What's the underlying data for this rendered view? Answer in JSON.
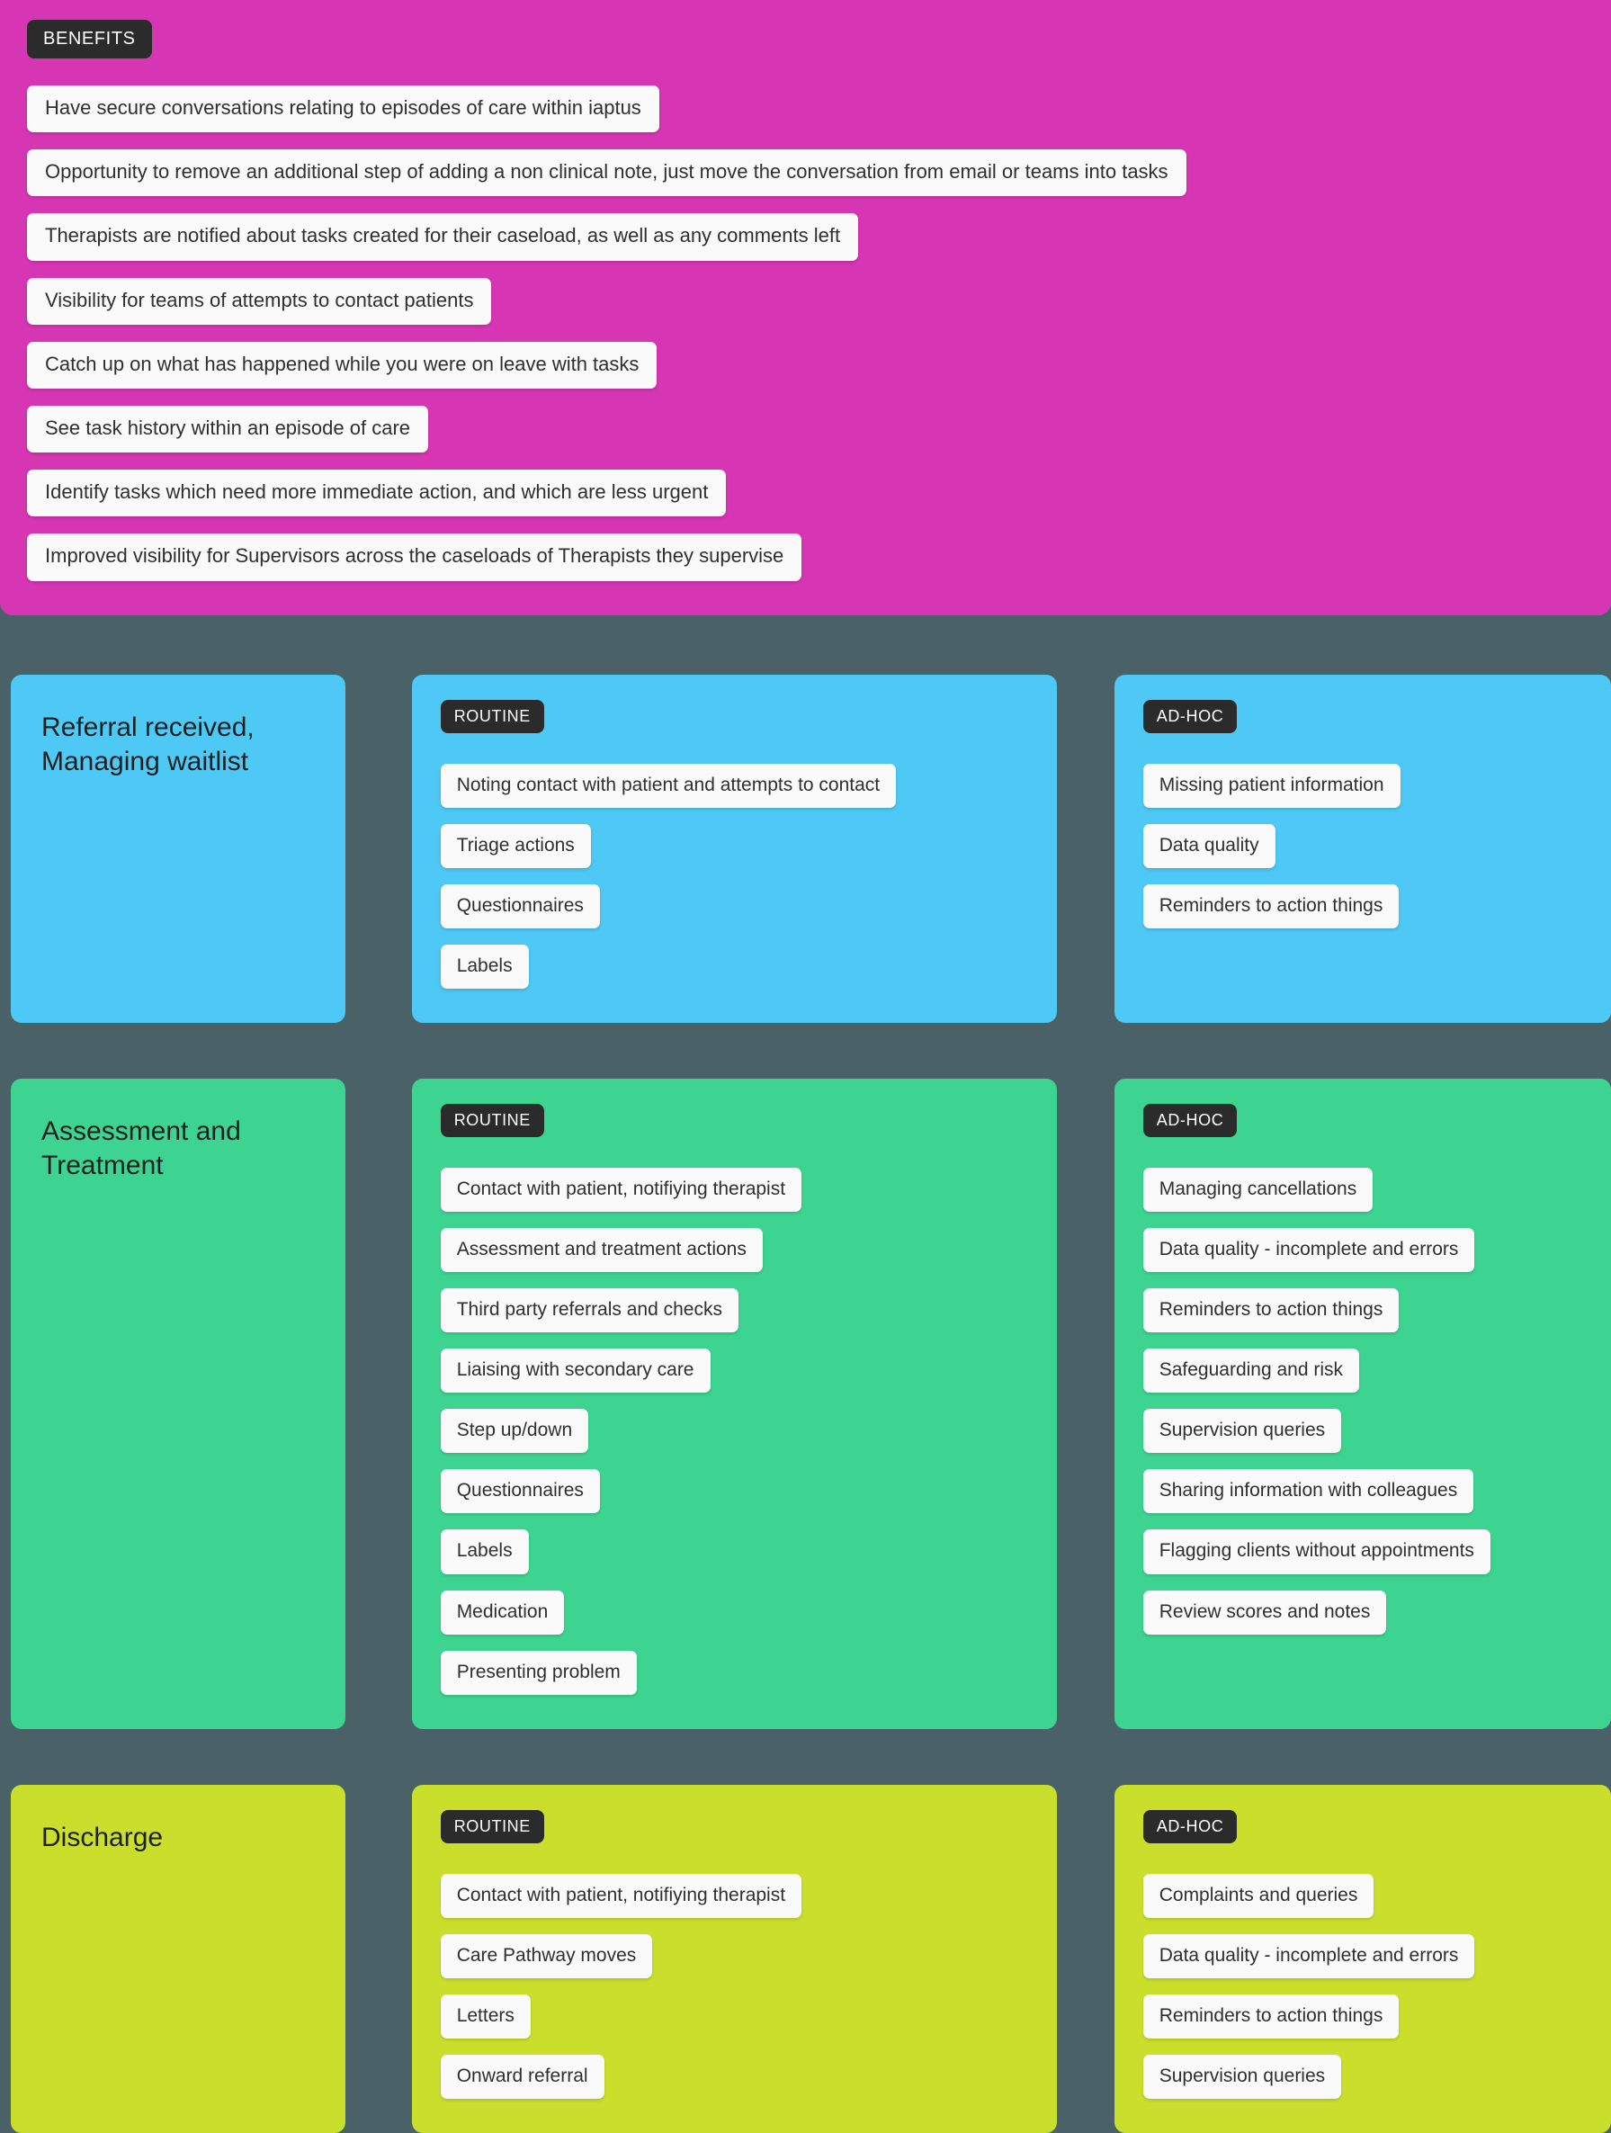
{
  "benefits": {
    "tag": "BENEFITS",
    "items": [
      "Have secure conversations relating to episodes of care within iaptus",
      "Opportunity to remove an additional step of adding a non clinical note, just move the conversation from email or teams into tasks",
      "Therapists are notified about tasks created for their caseload, as well as any comments left",
      "Visibility for teams of attempts to contact patients",
      "Catch up on what has happened while you were on leave with tasks",
      "See task history within an episode of care",
      "Identify tasks which need more immediate action, and which are less urgent",
      "Improved visibility for Supervisors across the caseloads of Therapists they supervise"
    ]
  },
  "colors": {
    "background": "#4a6168",
    "benefits_pink": "#d636b4",
    "stage_blue": "#4ec8f4",
    "stage_green": "#3dd492",
    "stage_yellow": "#cadf2c",
    "tag_dark": "#2b2b2b",
    "chip_white": "#fafafa"
  },
  "column_labels": {
    "routine": "ROUTINE",
    "adhoc": "AD-HOC"
  },
  "stages": [
    {
      "title": "Referral received,\nManaging waitlist",
      "color_key": "blue",
      "routine": [
        "Noting contact with patient and attempts to contact",
        "Triage actions",
        "Questionnaires",
        "Labels"
      ],
      "adhoc": [
        "Missing patient information",
        "Data quality",
        "Reminders to action things"
      ]
    },
    {
      "title": "Assessment and\nTreatment",
      "color_key": "green",
      "routine": [
        "Contact with patient, notifiying therapist",
        "Assessment and treatment actions",
        "Third party referrals and checks",
        "Liaising with secondary care",
        "Step up/down",
        "Questionnaires",
        "Labels",
        "Medication",
        "Presenting problem"
      ],
      "adhoc": [
        "Managing cancellations",
        "Data quality - incomplete and errors",
        "Reminders to action things",
        "Safeguarding and risk",
        "Supervision queries",
        "Sharing information with colleagues",
        "Flagging clients without appointments",
        "Review scores and notes"
      ]
    },
    {
      "title": "Discharge",
      "color_key": "yellow",
      "routine": [
        "Contact with patient, notifiying therapist",
        "Care Pathway moves",
        "Letters",
        "Onward referral"
      ],
      "adhoc": [
        "Complaints and queries",
        "Data quality - incomplete and errors",
        "Reminders to action things",
        "Supervision queries"
      ]
    }
  ]
}
